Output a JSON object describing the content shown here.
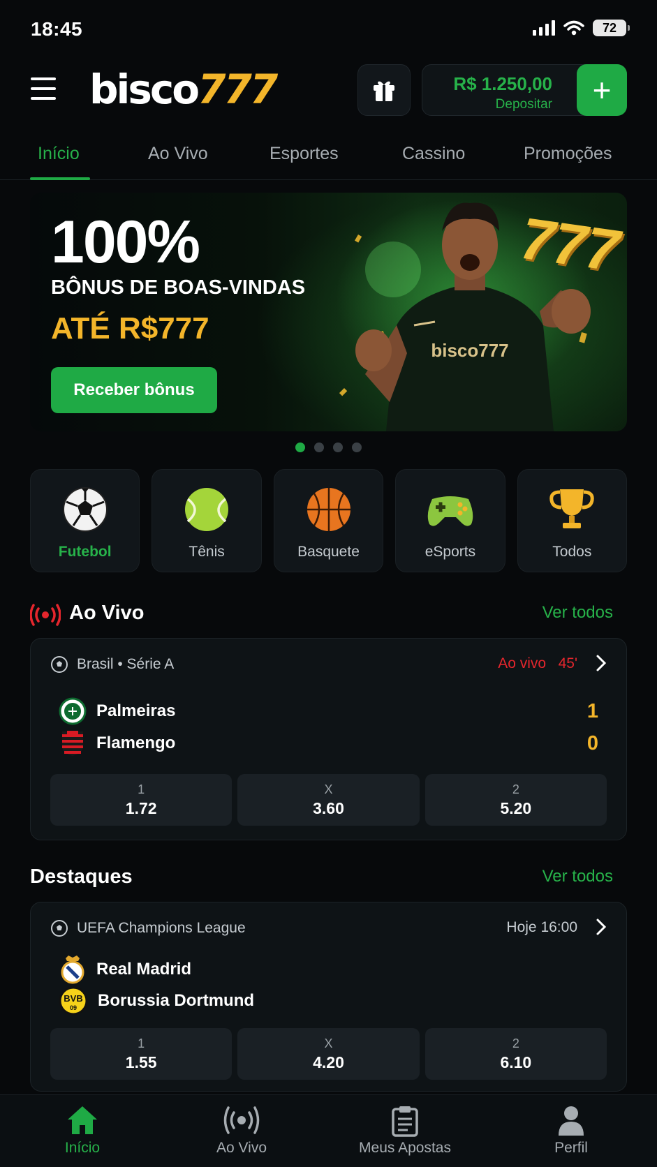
{
  "status_bar": {
    "time": "18:45",
    "battery": "72"
  },
  "header": {
    "logo_main": "bisco",
    "logo_accent": "777",
    "balance": "R$ 1.250,00",
    "deposit_label": "Depositar",
    "add_symbol": "+"
  },
  "tabs": [
    "Início",
    "Ao Vivo",
    "Esportes",
    "Cassino",
    "Promoções"
  ],
  "banner": {
    "title": "100%",
    "subtitle": "BÔNUS DE BOAS-VINDAS",
    "upto": "ATÉ R$777",
    "button": "Receber bônus",
    "decor_text": "777",
    "jersey_text": "bisco777",
    "slides": 4,
    "active_slide": 1
  },
  "sports": [
    "Futebol",
    "Tênis",
    "Basquete",
    "eSports",
    "Todos"
  ],
  "live_section": {
    "title": "Ao Vivo",
    "see_all": "Ver todos",
    "match": {
      "league": "Brasil • Série A",
      "status": "Ao vivo",
      "minute": "45'",
      "home": "Palmeiras",
      "away": "Flamengo",
      "home_score": "1",
      "away_score": "0",
      "odds": [
        {
          "label": "1",
          "value": "1.72"
        },
        {
          "label": "X",
          "value": "3.60"
        },
        {
          "label": "2",
          "value": "5.20"
        }
      ]
    }
  },
  "featured_section": {
    "title": "Destaques",
    "see_all": "Ver todos",
    "match": {
      "league": "UEFA Champions League",
      "time": "Hoje 16:00",
      "home": "Real Madrid",
      "away": "Borussia Dortmund",
      "odds": [
        {
          "label": "1",
          "value": "1.55"
        },
        {
          "label": "X",
          "value": "4.20"
        },
        {
          "label": "2",
          "value": "6.10"
        }
      ]
    }
  },
  "bottom_nav": [
    "Início",
    "Ao Vivo",
    "Meus Apostas",
    "Perfil"
  ],
  "colors": {
    "accent": "#1faa45",
    "gold": "#f3b52a",
    "live_red": "#e5262d",
    "background": "#07090b"
  }
}
